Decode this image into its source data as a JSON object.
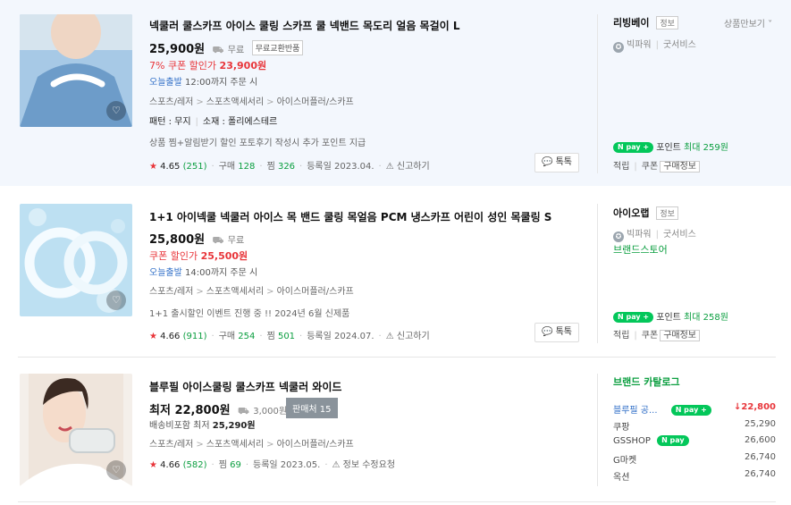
{
  "products": [
    {
      "title": "넥쿨러 쿨스카프 아이스 쿨링 스카프 쿨 넥밴드 목도리 얼음 목걸이 L",
      "price": "25,900원",
      "shipping": "무료",
      "tag": "무료교환반품",
      "coupon_label": "7% 쿠폰 할인가",
      "coupon_price": "23,900원",
      "today_label": "오늘출발",
      "today_text": "12:00까지 주문 시",
      "category": [
        "스포츠/레저",
        "스포츠액세서리",
        "아이스머플러/스카프"
      ],
      "attr_pattern": "패턴 : 무지",
      "attr_material": "소재 : 폴리에스테르",
      "desc": "상품 찜+알림받기 할인 포토후기 작성시 추가 포인트 지급",
      "rating": "4.65",
      "reviews": "(251)",
      "buy_label": "구매",
      "buy_count": "128",
      "zzim_label": "찜",
      "zzim_count": "326",
      "reg": "등록일 2023.04.",
      "report": "신고하기",
      "talk": "톡톡",
      "seller": "리빙베이",
      "seller_info": "정보",
      "more": "상품만보기",
      "badge1": "빅파워",
      "badge2": "굿서비스",
      "npay_label": "포인트",
      "npay_amount": "최대 259원",
      "save1": "적립",
      "save2": "쿠폰",
      "save3": "구매정보"
    },
    {
      "title": "1+1 아이넥쿨 넥쿨러 아이스 목 밴드 쿨링 목얼음 PCM 냉스카프 어린이 성인 목쿨링 S",
      "price": "25,800원",
      "shipping": "무료",
      "coupon_label": "쿠폰 할인가",
      "coupon_price": "25,500원",
      "today_label": "오늘출발",
      "today_text": "14:00까지 주문 시",
      "category": [
        "스포츠/레저",
        "스포츠액세서리",
        "아이스머플러/스카프"
      ],
      "desc": "1+1 출시할인 이벤트 진행 중 !! 2024년 6월 신제품",
      "rating": "4.66",
      "reviews": "(911)",
      "buy_label": "구매",
      "buy_count": "254",
      "zzim_label": "찜",
      "zzim_count": "501",
      "reg": "등록일 2024.07.",
      "report": "신고하기",
      "talk": "톡톡",
      "seller": "아이오랩",
      "seller_info": "정보",
      "badge1": "빅파워",
      "badge2": "굿서비스",
      "brand": "브랜드스토어",
      "npay_label": "포인트",
      "npay_amount": "최대 258원",
      "save1": "적립",
      "save2": "쿠폰",
      "save3": "구매정보"
    },
    {
      "title": "블루필 아이스쿨링 쿨스카프 넥쿨러 와이드",
      "price_prefix": "최저",
      "price": "22,800원",
      "shipping": "3,000원",
      "sellers_count": "판매처 15",
      "shipping_incl": "배송비포함 최저",
      "shipping_incl_price": "25,290원",
      "category": [
        "스포츠/레저",
        "스포츠액세서리",
        "아이스머플러/스카프"
      ],
      "rating": "4.66",
      "reviews": "(582)",
      "zzim_label": "찜",
      "zzim_count": "69",
      "reg": "등록일 2023.05.",
      "report": "정보 수정요청",
      "catalog_title": "브랜드 카탈로그",
      "malls": [
        {
          "name": "블루필 공...",
          "price": "22,800"
        },
        {
          "name": "쿠팡",
          "price": "25,290"
        },
        {
          "name": "GSSHOP",
          "price": "26,600"
        },
        {
          "name": "G마켓",
          "price": "26,740"
        },
        {
          "name": "옥션",
          "price": "26,740"
        }
      ]
    }
  ],
  "icons": {
    "npay": "npay",
    "npay_plus": "npay+",
    "heart": "heart-icon",
    "truck": "truck-icon",
    "talk": "talk-icon",
    "siren": "siren-icon",
    "medal": "medal-icon"
  },
  "colors": {
    "accent_red": "#e8353a",
    "accent_green": "#0a9e3f",
    "link_blue": "#2f6ec7",
    "npay_green": "#03c75a"
  }
}
